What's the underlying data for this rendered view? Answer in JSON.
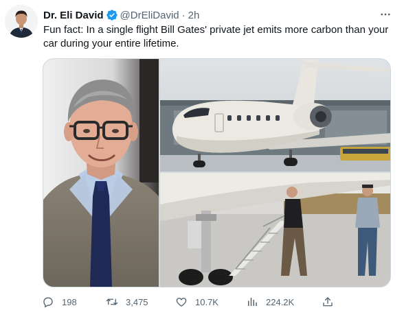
{
  "author": {
    "name": "Dr. Eli David",
    "handle": "@DrEliDavid",
    "separator": "·",
    "time": "2h",
    "verified": true,
    "avatar_icon": "profile-avatar"
  },
  "tweet": {
    "text": "Fun fact: In a single flight Bill Gates' private jet emits more carbon than your car during your entire lifetime."
  },
  "media": {
    "images": [
      {
        "name": "portrait-photo",
        "description_icon": "person-portrait"
      },
      {
        "name": "private-jet-photo",
        "description_icon": "jet-on-tarmac"
      },
      {
        "name": "boarding-stairs-photo",
        "description_icon": "jet-boarding-stairs"
      }
    ]
  },
  "actions": {
    "reply": {
      "icon": "reply-icon",
      "count": "198"
    },
    "retweet": {
      "icon": "retweet-icon",
      "count": "3,475"
    },
    "like": {
      "icon": "heart-icon",
      "count": "10.7K"
    },
    "views": {
      "icon": "views-icon",
      "count": "224.2K"
    },
    "share": {
      "icon": "share-icon"
    }
  },
  "colors": {
    "text_primary": "#0f1419",
    "text_secondary": "#536471",
    "verified_blue": "#1d9bf0",
    "border": "#cfd9de"
  }
}
